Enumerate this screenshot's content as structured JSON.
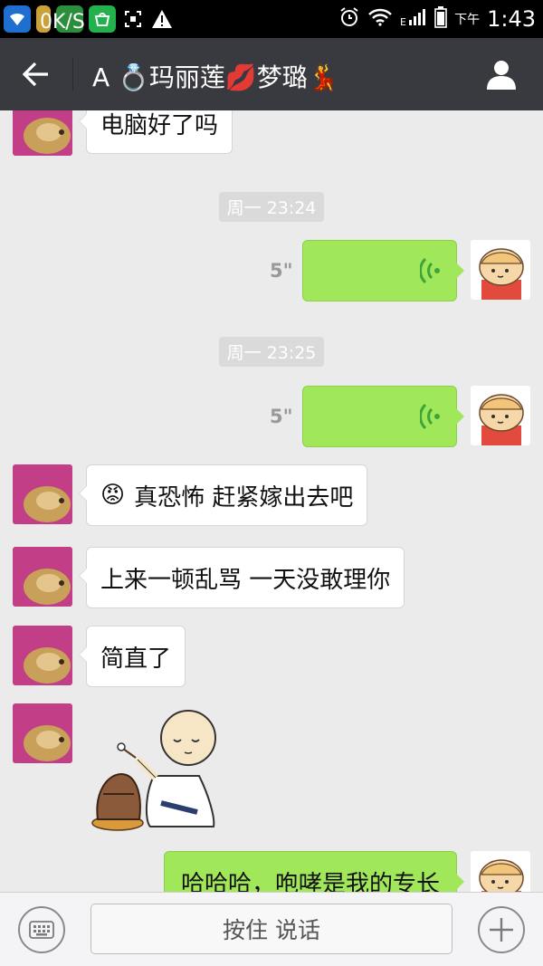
{
  "status_bar": {
    "net_speed": "0K/S",
    "am_pm": "下午",
    "time": "1:43",
    "icons": [
      "wifi-icon",
      "app-icon",
      "app-icon",
      "app-icon",
      "screenshot-icon",
      "warning-icon",
      "alarm-icon",
      "wifi-signal-icon",
      "cell-signal-icon",
      "battery-icon"
    ]
  },
  "header": {
    "title": "A 💍玛丽莲💋梦璐💃",
    "back_icon": "arrow-left-icon",
    "profile_icon": "person-icon",
    "background": "#393a3f"
  },
  "messages": [
    {
      "side": "left",
      "type": "text",
      "text": "电脑好了吗"
    },
    {
      "type": "time",
      "text": "周一 23:24"
    },
    {
      "side": "right",
      "type": "voice",
      "duration": "5\""
    },
    {
      "type": "time",
      "text": "周一 23:25"
    },
    {
      "side": "right",
      "type": "voice",
      "duration": "5\""
    },
    {
      "side": "left",
      "type": "text",
      "emoji": "😡",
      "text": "真恐怖 赶紧嫁出去吧"
    },
    {
      "side": "left",
      "type": "text",
      "text": "上来一顿乱骂 一天没敢理你"
    },
    {
      "side": "left",
      "type": "text",
      "text": "简直了"
    },
    {
      "side": "left",
      "type": "sticker",
      "sticker": "monk-wooden-fish-sticker"
    },
    {
      "side": "right",
      "type": "text",
      "text": "哈哈哈，咆哮是我的专长"
    }
  ],
  "input_bar": {
    "keyboard_icon": "keyboard-icon",
    "hold_to_talk": "按住 说话",
    "plus_icon": "plus-icon"
  },
  "colors": {
    "chat_bg": "#ebebeb",
    "sent_bubble": "#a0e75a",
    "received_bubble": "#ffffff",
    "voice_wave": "#3fa538"
  }
}
